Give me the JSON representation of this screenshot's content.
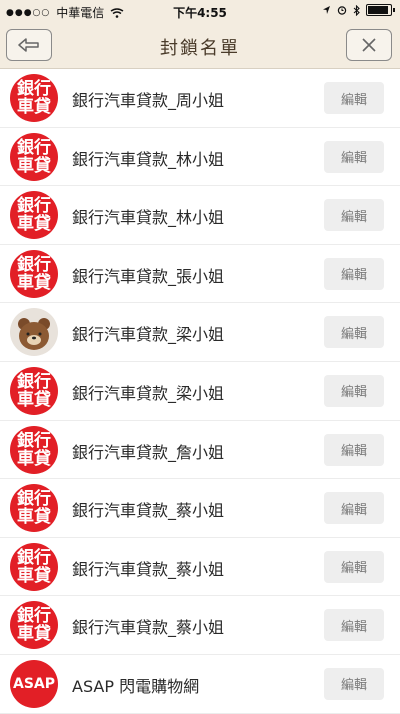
{
  "status_bar": {
    "carrier": "中華電信",
    "time": "下午4:55"
  },
  "nav": {
    "title": "封鎖名單",
    "back_icon": "back-arrow-icon",
    "close_icon": "close-icon"
  },
  "rows": [
    {
      "avatar_type": "bank",
      "avatar_line1": "銀行",
      "avatar_line2": "車貸",
      "name": "銀行汽車貸款_周小姐",
      "edit_label": "編輯"
    },
    {
      "avatar_type": "bank",
      "avatar_line1": "銀行",
      "avatar_line2": "車貸",
      "name": "銀行汽車貸款_林小姐",
      "edit_label": "編輯"
    },
    {
      "avatar_type": "bank",
      "avatar_line1": "銀行",
      "avatar_line2": "車貸",
      "name": "銀行汽車貸款_林小姐",
      "edit_label": "編輯"
    },
    {
      "avatar_type": "bank",
      "avatar_line1": "銀行",
      "avatar_line2": "車貸",
      "name": "銀行汽車貸款_張小姐",
      "edit_label": "編輯"
    },
    {
      "avatar_type": "bear",
      "avatar_line1": "",
      "avatar_line2": "",
      "name": "銀行汽車貸款_梁小姐",
      "edit_label": "編輯"
    },
    {
      "avatar_type": "bank",
      "avatar_line1": "銀行",
      "avatar_line2": "車貸",
      "name": "銀行汽車貸款_梁小姐",
      "edit_label": "編輯"
    },
    {
      "avatar_type": "bank",
      "avatar_line1": "銀行",
      "avatar_line2": "車貸",
      "name": "銀行汽車貸款_詹小姐",
      "edit_label": "編輯"
    },
    {
      "avatar_type": "bank",
      "avatar_line1": "銀行",
      "avatar_line2": "車貸",
      "name": "銀行汽車貸款_蔡小姐",
      "edit_label": "編輯"
    },
    {
      "avatar_type": "bank",
      "avatar_line1": "銀行",
      "avatar_line2": "車貸",
      "name": "銀行汽車貸款_蔡小姐",
      "edit_label": "編輯"
    },
    {
      "avatar_type": "bank",
      "avatar_line1": "銀行",
      "avatar_line2": "車貸",
      "name": "銀行汽車貸款_蔡小姐",
      "edit_label": "編輯"
    },
    {
      "avatar_type": "asap",
      "avatar_line1": "ASAP",
      "avatar_line2": "",
      "name": "ASAP 閃電購物網",
      "edit_label": "編輯"
    }
  ],
  "colors": {
    "header_bg": "#f3ece0",
    "avatar_red": "#e21f26",
    "edit_bg": "#eeeeee"
  }
}
